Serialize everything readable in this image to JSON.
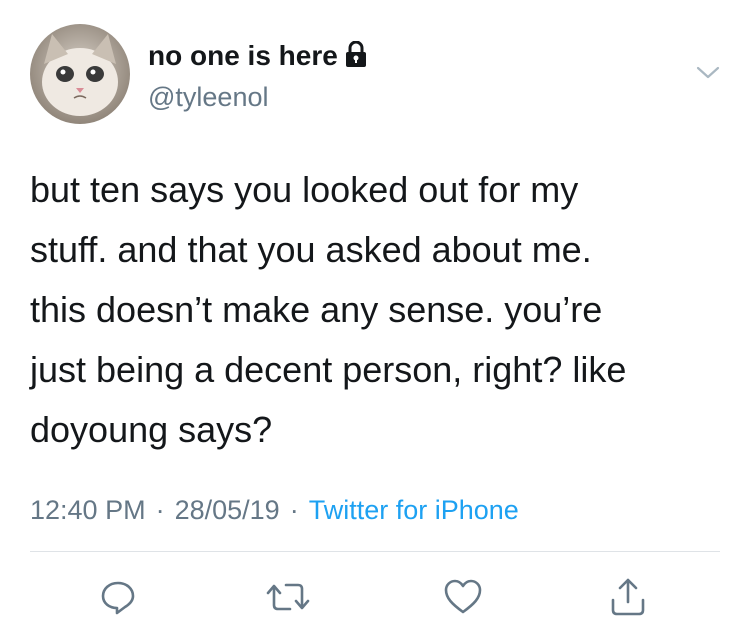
{
  "user": {
    "display_name": "no one is here",
    "handle": "@tyleenol",
    "avatar": "avatar (crying cat)",
    "protected_icon": "lock-icon"
  },
  "tweet": {
    "lines": [
      "but ten says you looked out for my",
      "stuff. and that you asked about me.",
      "this doesn’t make any sense. you’re",
      "just being a decent person, right? like",
      "doyoung says?"
    ]
  },
  "meta": {
    "time": "12:40 PM",
    "separator": "·",
    "date": "28/05/19",
    "source": "Twitter for iPhone"
  },
  "actions": {
    "reply_icon": "reply-icon",
    "retweet_icon": "retweet-icon",
    "like_icon": "heart-icon",
    "share_icon": "share-icon"
  },
  "colors": {
    "text": "#14171a",
    "secondary": "#657786",
    "link": "#1da1f2",
    "divider": "#dfe3e7"
  }
}
